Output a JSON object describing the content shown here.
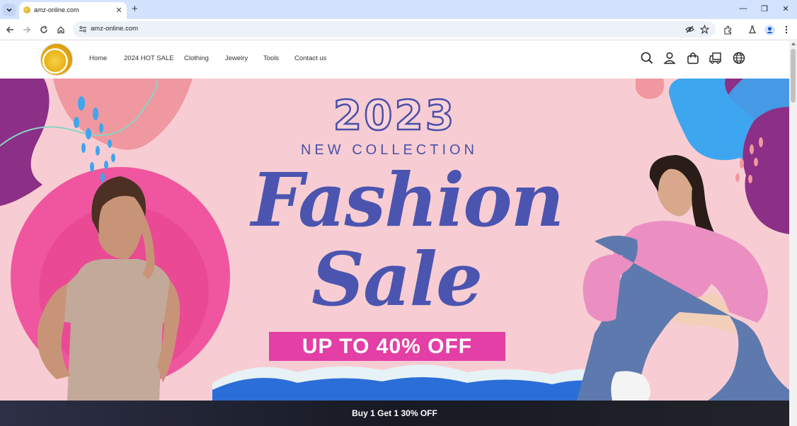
{
  "browser": {
    "tab_title": "amz-online.com",
    "new_tab_symbol": "+",
    "url": "amz-online.com",
    "window_controls": {
      "minimize": "—",
      "maximize": "❐",
      "close": "✕"
    }
  },
  "site": {
    "nav": [
      "Home",
      "2024 HOT SALE",
      "Clothing",
      "Jewelry",
      "Tools",
      "Contact us"
    ],
    "header_icons": [
      "search-icon",
      "account-icon",
      "cart-icon",
      "delivery-icon",
      "globe-icon"
    ]
  },
  "hero": {
    "year": "2023",
    "subtitle": "NEW COLLECTION",
    "headline_line1": "Fashion",
    "headline_line2": "Sale",
    "badge": "UP TO 40% OFF",
    "colors": {
      "background": "#f7cdd3",
      "text": "#4b55b0",
      "badge": "#e33fa6",
      "magenta": "#f0569f",
      "purple": "#8c2f86",
      "blue": "#3ea6ef"
    }
  },
  "announcement": {
    "text": "Buy 1 Get 1 30% OFF"
  }
}
